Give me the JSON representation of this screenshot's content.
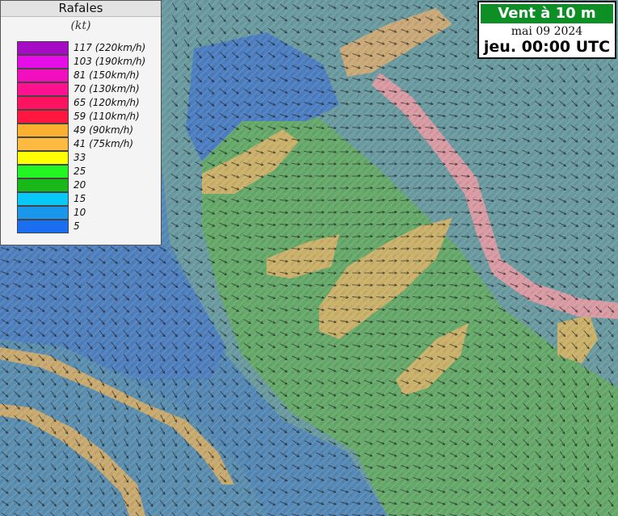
{
  "legend": {
    "title": "Rafales",
    "unit": "(kt)",
    "rows": [
      {
        "label": "117 (220km/h)",
        "color": "#a50cc4"
      },
      {
        "label": "103 (190km/h)",
        "color": "#e60de6"
      },
      {
        "label": "81 (150km/h)",
        "color": "#f20fbe"
      },
      {
        "label": "70 (130km/h)",
        "color": "#ff1290"
      },
      {
        "label": "65 (120km/h)",
        "color": "#ff1260"
      },
      {
        "label": "59 (110km/h)",
        "color": "#ff1740"
      },
      {
        "label": "49 (90km/h)",
        "color": "#fbb030"
      },
      {
        "label": "41 (75km/h)",
        "color": "#fcba40"
      },
      {
        "label": "33",
        "color": "#ffff00"
      },
      {
        "label": "25",
        "color": "#22f522"
      },
      {
        "label": "20",
        "color": "#18b818"
      },
      {
        "label": "15",
        "color": "#08c8f8"
      },
      {
        "label": "10",
        "color": "#1a96ea"
      },
      {
        "label": "5",
        "color": "#1a6ef0"
      }
    ]
  },
  "titlebox": {
    "title": "Vent à 10 m",
    "date": "mai 09 2024",
    "time": "jeu. 00:00 UTC"
  },
  "colors": {
    "sea_low": "#5b8fb8",
    "sea_mid": "#6fa3a8",
    "green_area": "#6fae6a",
    "tan_area": "#c2ad6c",
    "ridge_pink": "#d69aa0",
    "arrow": "#1c1c1c"
  }
}
